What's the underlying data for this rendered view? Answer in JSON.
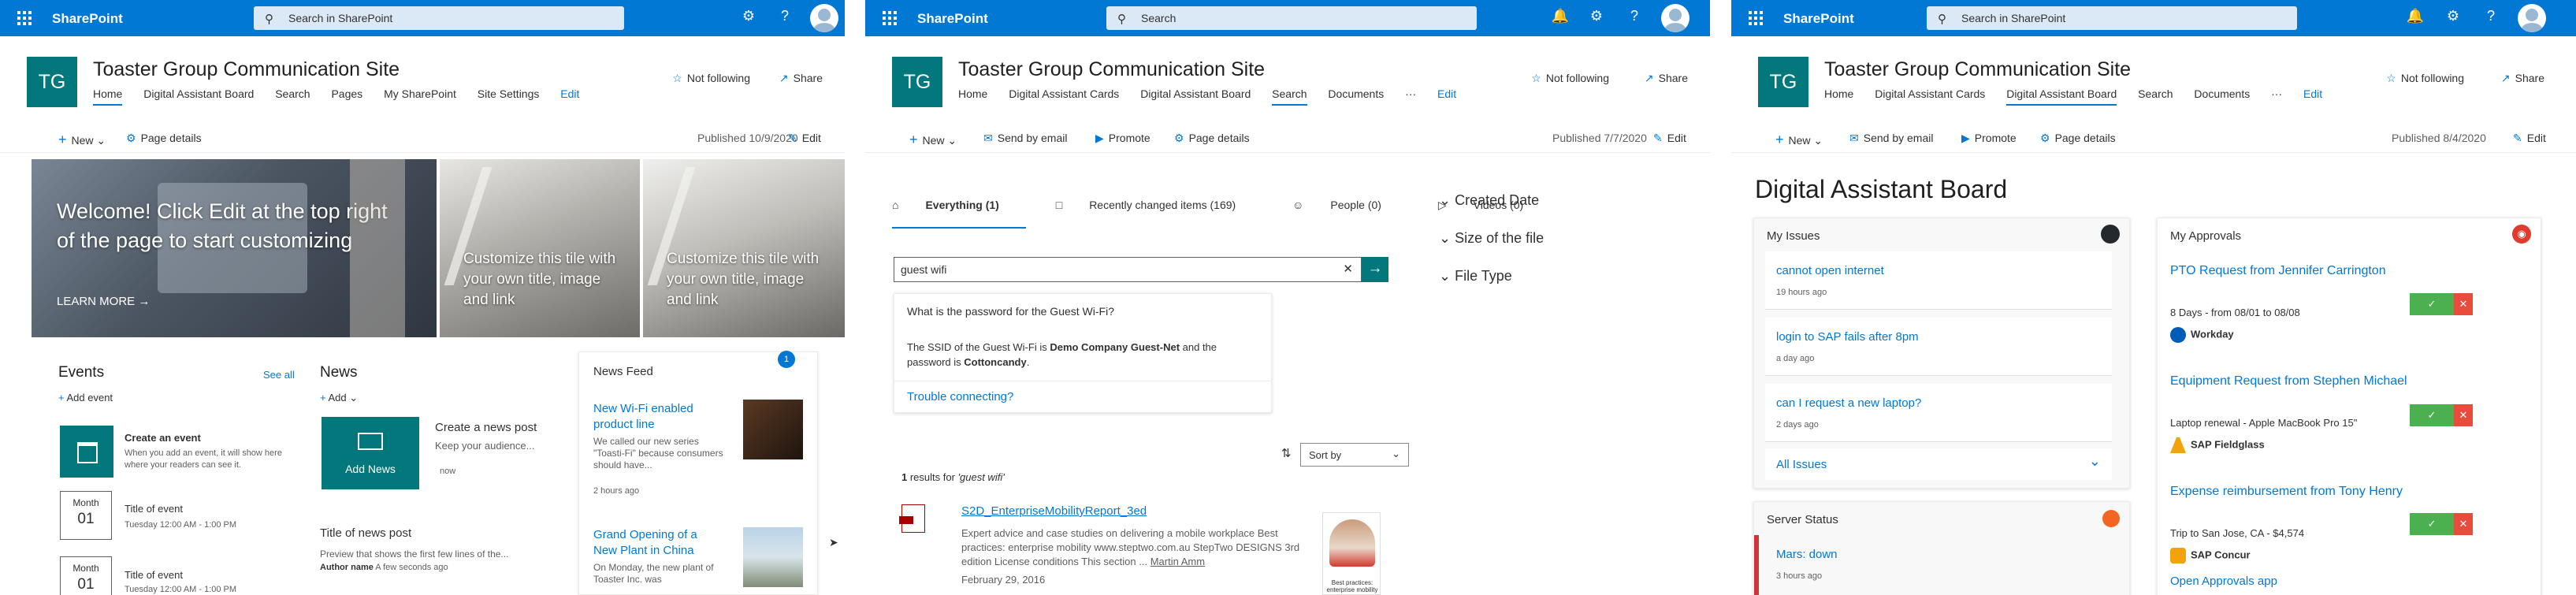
{
  "suite": {
    "brand": "SharePoint",
    "search_site": "Search in SharePoint",
    "search_plain": "Search"
  },
  "site": {
    "logo": "TG",
    "title": "Toaster Group Communication Site",
    "not_following": "Not following",
    "share": "Share"
  },
  "frame1": {
    "nav": [
      "Home",
      "Digital Assistant Board",
      "Search",
      "Pages",
      "My SharePoint",
      "Site Settings",
      "Edit"
    ],
    "new": "New",
    "page_details": "Page details",
    "published": "Published 10/9/2020",
    "edit": "Edit",
    "hero": {
      "main": "Welcome! Click Edit at the top right of the page to start customizing",
      "learn_more": "LEARN MORE →",
      "tile2": "Customize this tile with your own title, image and link",
      "tile3": "Customize this tile with your own title, image and link"
    },
    "events": {
      "title": "Events",
      "see_all": "See all",
      "add": "Add event",
      "create_title": "Create an event",
      "create_desc": "When you add an event, it will show here where your readers can see it.",
      "items": [
        {
          "month": "Month",
          "day": "01",
          "title": "Title of event",
          "time": "Tuesday 12:00 AM - 1:00 PM"
        },
        {
          "month": "Month",
          "day": "01",
          "title": "Title of event",
          "time": "Tuesday 12:00 AM - 1:00 PM"
        }
      ]
    },
    "news": {
      "title": "News",
      "add": "Add",
      "add_news": "Add News",
      "create_title": "Create a news post",
      "create_desc": "Keep your audience...",
      "now": "now",
      "post_title": "Title of news post",
      "post_desc": "Preview that shows the first few lines of the...",
      "author": "Author name",
      "ago": "A few seconds ago"
    },
    "feed": {
      "title": "News Feed",
      "badge": "1",
      "items": [
        {
          "title": "New Wi-Fi enabled product line",
          "desc": "We called our new series \"Toasti-Fi\" because consumers should have...",
          "time": "2 hours ago"
        },
        {
          "title": "Grand Opening of a New Plant in China",
          "desc": "On Monday, the new plant of Toaster Inc. was"
        }
      ]
    }
  },
  "frame2": {
    "nav": [
      "Home",
      "Digital Assistant Cards",
      "Digital Assistant Board",
      "Search",
      "Documents",
      "···",
      "Edit"
    ],
    "new": "New",
    "send_email": "Send by email",
    "promote": "Promote",
    "page_details": "Page details",
    "published": "Published 7/7/2020",
    "edit": "Edit",
    "tabs": [
      "Everything (1)",
      "Recently changed items (169)",
      "People (0)",
      "Videos (0)"
    ],
    "query": "guest wifi",
    "qa": {
      "question": "What is the password for the Guest Wi-Fi?",
      "answer_pre": "The SSID of the Guest Wi-Fi is ",
      "ssid": "Demo Company Guest-Net",
      "answer_mid": " and the password is ",
      "password": "Cottoncandy",
      "answer_end": ".",
      "link": "Trouble connecting?"
    },
    "filters": [
      "Created Date",
      "Size of the file",
      "File Type"
    ],
    "sort": "Sort by",
    "results_count": "1",
    "results_text": " results for ",
    "results_query": "'guest wifi'",
    "result": {
      "title": "S2D_EnterpriseMobilityReport_3ed",
      "snippet": "Expert advice and case studies on delivering a mobile workplace Best practices: enterprise mobility www.steptwo.com.au StepTwo DESIGNS 3rd edition License conditions This section ...",
      "author": "Martin Amm",
      "date": "February 29, 2016",
      "thumb_caption": "Best practices: enterprise mobility"
    }
  },
  "frame3": {
    "nav": [
      "Home",
      "Digital Assistant Cards",
      "Digital Assistant Board",
      "Search",
      "Documents",
      "···",
      "Edit"
    ],
    "new": "New",
    "send_email": "Send by email",
    "promote": "Promote",
    "page_details": "Page details",
    "published": "Published 8/4/2020",
    "edit": "Edit",
    "board_title": "Digital Assistant Board",
    "issues": {
      "title": "My Issues",
      "all": "All Issues",
      "items": [
        {
          "title": "cannot open internet",
          "time": "19 hours ago"
        },
        {
          "title": "login to SAP fails after 8pm",
          "time": "a day ago"
        },
        {
          "title": "can I request a new laptop?",
          "time": "2 days ago"
        }
      ]
    },
    "server": {
      "title": "Server Status",
      "item": "Mars: down",
      "time": "3 hours ago"
    },
    "approvals": {
      "title": "My Approvals",
      "approve": "✓ Approve",
      "open": "Open Approvals app",
      "items": [
        {
          "title": "PTO Request from Jennifer Carrington",
          "desc": "8 Days - from 08/01 to 08/08",
          "source": "Workday"
        },
        {
          "title": "Equipment Request from Stephen Michael",
          "desc": "Laptop renewal - Apple MacBook Pro 15\"",
          "source": "SAP Fieldglass"
        },
        {
          "title": "Expense reimbursement from Tony Henry",
          "desc": "Trip to San Jose, CA - $4,574",
          "source": "SAP Concur"
        }
      ]
    }
  }
}
